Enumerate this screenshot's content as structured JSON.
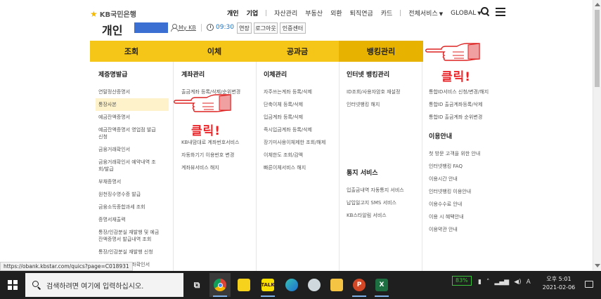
{
  "header": {
    "logo": "KB국민은행",
    "nav": [
      {
        "label": "개인",
        "bold": true
      },
      {
        "label": "기업",
        "bold": true
      },
      {
        "label": "자산관리"
      },
      {
        "label": "부동산"
      },
      {
        "label": "외환"
      },
      {
        "label": "퇴직연금"
      },
      {
        "label": "카드"
      },
      {
        "label": "전체서비스"
      },
      {
        "label": "GLOBAL"
      }
    ],
    "section_title": "개인",
    "mykb": "My KB",
    "timer": "09:30",
    "buttons": [
      "연장",
      "로그아웃",
      "인증센터"
    ]
  },
  "main_menu": [
    "조회",
    "이체",
    "공과금",
    "뱅킹관리"
  ],
  "columns": [
    {
      "title": "제증명발급",
      "items": [
        "연말정산증명서",
        "통장사본",
        "예금잔액증명서",
        "예금잔액증명서 영업점 발급\n신청",
        "금융거래확인서",
        "금융거래확인서 예약내역 조\n회/발급",
        "부채증명서",
        "원천징수영수증 발급",
        "금융소득종합과세 조회",
        "증명서재출력",
        "통장/인감분실 재발행 및 예금\n잔액증명서 발급내역 조회",
        "통장/인감분실 재발행 신청",
        "자동이체내역 계좌확인서"
      ],
      "highlight_index": 1
    },
    {
      "title": "계좌관리",
      "items": [
        "출금계좌 등록/삭제/순위변경",
        "",
        "",
        "",
        "KB내맘대로 계좌번호서비스",
        "자동화기기 이용번호 변경",
        "계좌뷰서비스 해지"
      ]
    },
    {
      "title": "이체관리",
      "items": [
        "자주쓰는계좌 등록/삭제",
        "단축이체 등록/삭제",
        "입금계좌 등록/삭제",
        "즉시입금계좌 등록/삭제",
        "장기미사용이체제한 조회/해제",
        "이체한도 조회/감액",
        "빠른이체서비스 해지"
      ]
    },
    {
      "title": "인터넷 뱅킹관리",
      "items": [
        "ID조회/사용자암호 재설정",
        "인터넷뱅킹 해지"
      ],
      "title2": "통지 서비스",
      "items2": [
        "입출금내역 자동통지 서비스",
        "납입일고지 SMS 서비스",
        "KB스타알림 서비스"
      ]
    },
    {
      "title": "",
      "items": [
        "통합ID서비스 신청/변경/해지",
        "통합ID 출금계좌등록/삭제",
        "통합ID 출금계좌 순위변경"
      ],
      "title2": "이용안내",
      "items2": [
        "첫 방문 고객을 위한 안내",
        "인터넷뱅킹 FAQ",
        "이용시간 안내",
        "인터넷뱅킹 이용안내",
        "이용수수료 안내",
        "이용 시 혜택안내",
        "이용약관 안내"
      ]
    }
  ],
  "annotation_label": "클릭!",
  "status_url": "https://obank.kbstar.com/quics?page=C018931",
  "taskbar": {
    "search_placeholder": "검색하려면 여기에 입력하십시오.",
    "battery": "83%",
    "time": "오후 5:01",
    "date": "2021-02-06"
  },
  "colors": {
    "menu_yellow": "#f5c518",
    "menu_active": "#e8b300",
    "annotation_red": "#e8262a",
    "masked_box": "#3b6fd1"
  }
}
